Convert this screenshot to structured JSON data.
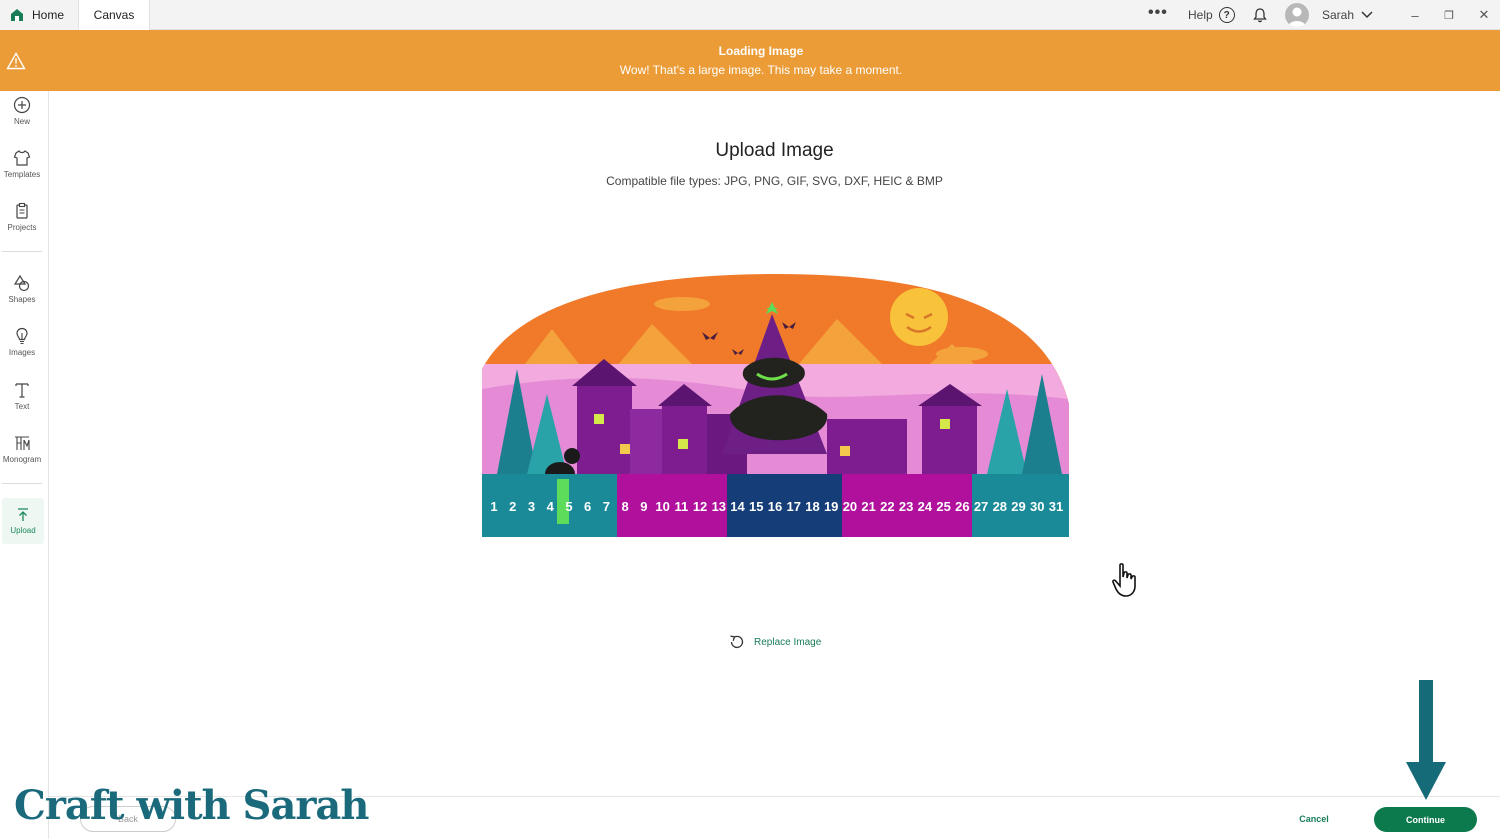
{
  "tabs": {
    "home": "Home",
    "canvas": "Canvas"
  },
  "header": {
    "more": "•••",
    "help": "Help",
    "help_icon": "?",
    "user": "Sarah"
  },
  "window_controls": {
    "minimize": "–",
    "restore": "❐",
    "close": "✕"
  },
  "banner": {
    "title": "Loading Image",
    "message": "Wow! That's a large image. This may take a moment.",
    "color": "#eb9c37"
  },
  "sidebar": {
    "items": [
      {
        "label": "New",
        "icon": "plus-circle-icon"
      },
      {
        "label": "Templates",
        "icon": "shirt-icon"
      },
      {
        "label": "Projects",
        "icon": "clipboard-icon"
      },
      {
        "label": "Shapes",
        "icon": "shapes-icon"
      },
      {
        "label": "Images",
        "icon": "lightbulb-icon"
      },
      {
        "label": "Text",
        "icon": "text-icon"
      },
      {
        "label": "Monogram",
        "icon": "monogram-icon"
      },
      {
        "label": "Upload",
        "icon": "upload-icon"
      }
    ]
  },
  "main": {
    "title": "Upload Image",
    "subtitle": "Compatible file types:  JPG, PNG, GIF, SVG, DXF, HEIC & BMP",
    "replace": "Replace Image",
    "calendar_days": [
      "1",
      "2",
      "3",
      "4",
      "5",
      "6",
      "7",
      "8",
      "9",
      "10",
      "11",
      "12",
      "13",
      "14",
      "15",
      "16",
      "17",
      "18",
      "19",
      "20",
      "21",
      "22",
      "23",
      "24",
      "25",
      "26",
      "27",
      "28",
      "29",
      "30",
      "31"
    ]
  },
  "footer": {
    "back": "Back",
    "cancel": "Cancel",
    "continue": "Continue",
    "accent": "#0d7a4d"
  },
  "watermark": "Craft with Sarah"
}
